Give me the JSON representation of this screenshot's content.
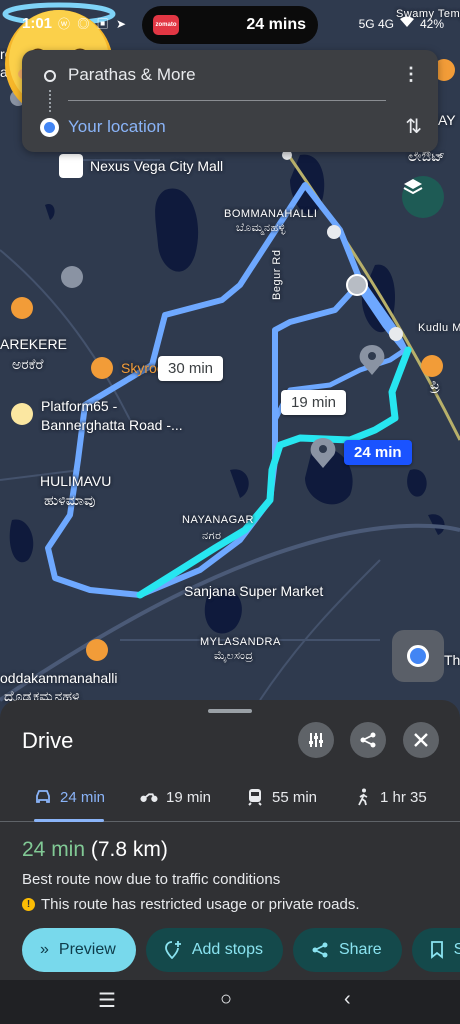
{
  "status_bar": {
    "time": "1:01",
    "app_icons": "ⓦ ◎ ▣ ➤",
    "signal": "5G 4G",
    "battery": "42%"
  },
  "live_activity": {
    "app_logo_text": "zomato",
    "eta": "24 mins"
  },
  "directions": {
    "origin": "Parathas & More",
    "destination": "Your location"
  },
  "map": {
    "labels": {
      "nexus": "Nexus Vega City Mall",
      "bommanahalli": "BOMMANAHALLI",
      "bommanahalli_kn": "ಬೊಮ್ಮನಹಳ್ಳಿ",
      "arekere": "AREKERE",
      "arekere_kn": "ಅರಕೆರೆ",
      "skyroo": "Skyroo",
      "platform65": "Platform65 -",
      "platform65_2": "Bannerghatta Road -...",
      "hulimavu": "HULIMAVU",
      "hulimavu_kn": "ಹುಳಿಮಾವು",
      "nayanagar": "NAYANAGAR",
      "nayanagar_kn": "ನಗರ",
      "sanjana": "Sanjana Super Market",
      "mylasandra": "MYLASANDRA",
      "mylasandra_kn": "ಮೈಲಸಂದ್ರ",
      "doddakammanahalli": "oddakammanahalli",
      "doddakammanahalli_kn": "ದೊಡ್ಡಕಮ್ಮನಹಳ್ಳಿ",
      "begur_rd": "Begur Rd",
      "kudlu": "Kudlu M",
      "swamy": "Swamy Temp",
      "corner_tl1": "rolog",
      "corner_tl2": "ath",
      "corner_r": "AY",
      "corner_r2": "ಲೇಔಟ್",
      "corner_r3": "ಪ್ರಿ",
      "corner_r4": "Th",
      "road_m": "M"
    },
    "route_badges": {
      "alt1": "30 min",
      "alt2": "19 min",
      "best": "24 min"
    }
  },
  "sheet": {
    "title": "Drive",
    "modes": [
      {
        "label": "24 min",
        "icon": "car-icon"
      },
      {
        "label": "19 min",
        "icon": "motorbike-icon"
      },
      {
        "label": "55 min",
        "icon": "transit-icon"
      },
      {
        "label": "1 hr 35",
        "icon": "walk-icon"
      }
    ],
    "summary_time": "24 min",
    "summary_distance": "(7.8 km)",
    "note": "Best route now due to traffic conditions",
    "warning": "This route has restricted usage or private roads.",
    "actions": {
      "preview": "Preview",
      "add_stops": "Add stops",
      "share": "Share",
      "save": "Sa"
    }
  },
  "colors": {
    "best_route": "#27e6f0",
    "alt_route": "#6ea8ff",
    "map_bg": "#2f3a4e",
    "water": "#0f1a3c"
  }
}
